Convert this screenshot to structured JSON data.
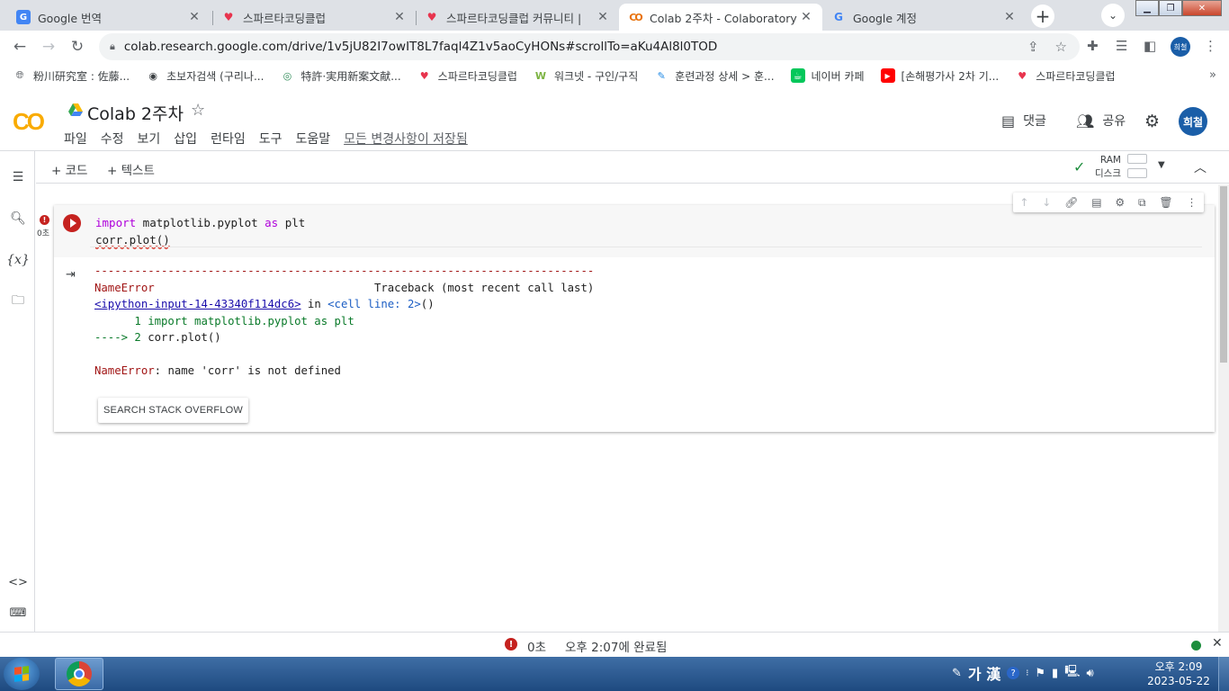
{
  "browser": {
    "tabs": [
      {
        "title": "Google 번역",
        "favicon": "google-translate-icon",
        "active": false
      },
      {
        "title": "스파르타코딩클럽",
        "favicon": "sparta-heart-icon",
        "active": false
      },
      {
        "title": "스파르타코딩클럽 커뮤니티 |",
        "favicon": "sparta-heart-icon",
        "active": false
      },
      {
        "title": "Colab 2주차 - Colaboratory",
        "favicon": "colab-icon",
        "active": true
      },
      {
        "title": "Google 계정",
        "favicon": "google-g-icon",
        "active": false
      }
    ],
    "url": "colab.research.google.com/drive/1v5jU82I7owIT8L7faql4Z1v5aoCyHONs#scrollTo=aKu4Al8l0TOD",
    "profile_initials": "희철",
    "bookmarks": [
      "粉川研究室 : 佐藤...",
      "초보자검색 (구리나...",
      "特許·実用新案文献...",
      "스파르타코딩클럽",
      "워크넷 - 구인/구직",
      "훈련과정 상세 > 훈...",
      "네이버 카페",
      "[손해평가사 2차 기...",
      "스파르타코딩클럽"
    ]
  },
  "colab": {
    "logo": "CO",
    "notebook_title": "Colab 2주차",
    "menus": [
      "파일",
      "수정",
      "보기",
      "삽입",
      "런타임",
      "도구",
      "도움말"
    ],
    "save_status": "모든 변경사항이 저장됨",
    "comment_label": "댓글",
    "share_label": "공유",
    "avatar_initials": "희철",
    "add_code": "+ 코드",
    "add_text": "+ 텍스트",
    "ram_label": "RAM",
    "disk_label": "디스크",
    "exec_time": "0초",
    "code_line1_kw1": "import",
    "code_line1_mod": " matplotlib.pyplot ",
    "code_line1_kw2": "as",
    "code_line1_alias": " plt",
    "code_line2": "corr.plot()",
    "output": {
      "dashes": "---------------------------------------------------------------------------",
      "err_name": "NameError",
      "traceback_header": "                                 Traceback (most recent call last)",
      "input_link": "<ipython-input-14-43340f114dc6>",
      "in_text": " in ",
      "cell_line": "<cell line: 2>",
      "cell_parens": "()",
      "line1": "      1 import matplotlib.pyplot as plt",
      "arrow": "----> 2 ",
      "line2": "corr.plot()",
      "err_msg": ": name 'corr' is not defined"
    },
    "so_button": "SEARCH STACK OVERFLOW",
    "status_time": "0초",
    "status_done": "오후 2:07에 완료됨"
  },
  "taskbar": {
    "ime": "가 漢",
    "clock_time": "오후 2:09",
    "clock_date": "2023-05-22"
  },
  "colors": {
    "error_red": "#c5221f",
    "keyword_purple": "#af00db",
    "ok_green": "#1e8e3e",
    "profile_blue": "#1a5ea8"
  }
}
